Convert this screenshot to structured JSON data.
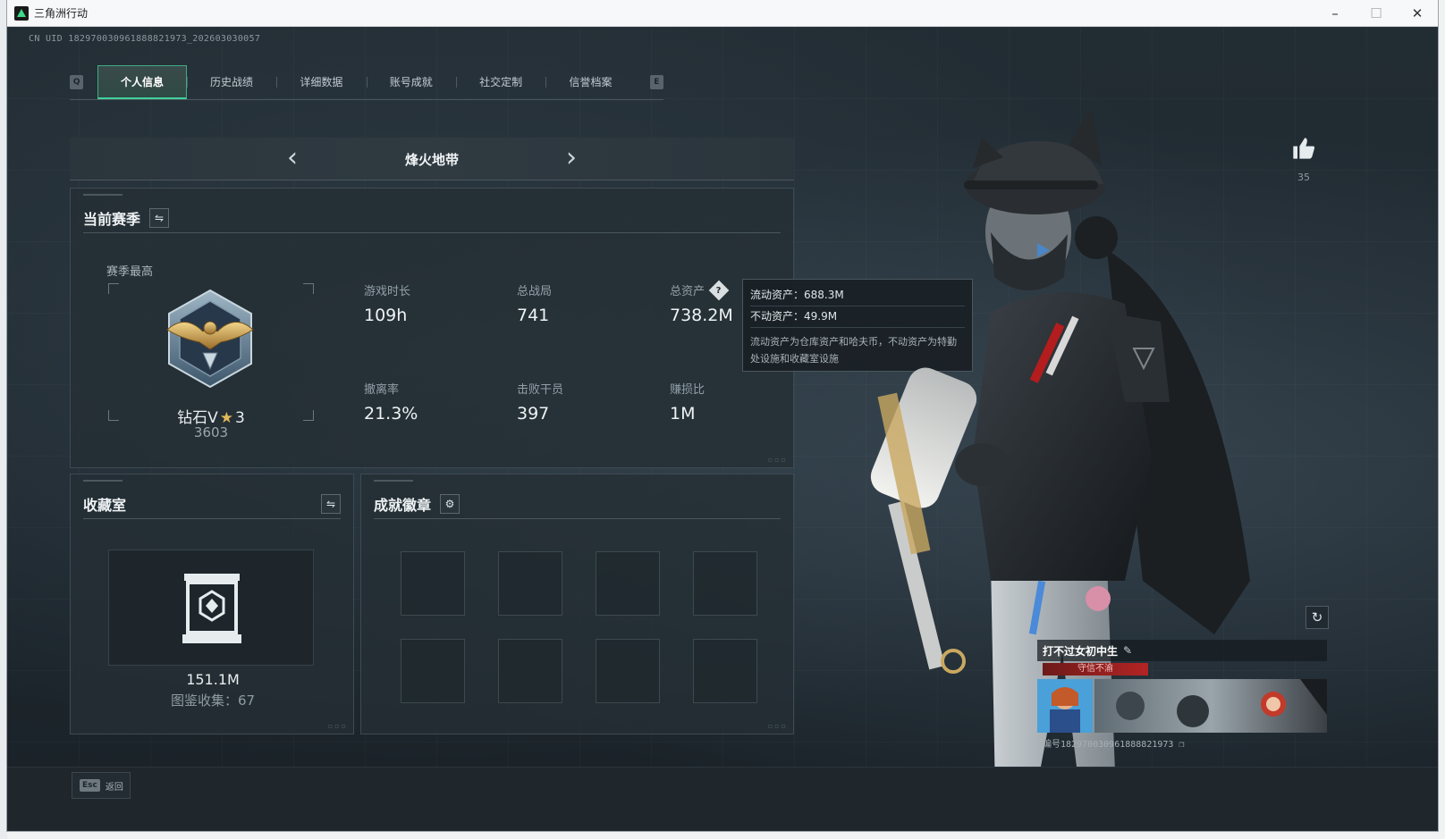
{
  "window": {
    "title": "三角洲行动",
    "controls": {
      "minimize": "–",
      "maximize": "☐",
      "close": "✕"
    }
  },
  "uid_text": "CN UID 1829700309618888219​73_202603030057",
  "tabs": {
    "left_key": "Q",
    "right_key": "E",
    "items": [
      {
        "label": "个人信息",
        "active": true
      },
      {
        "label": "历史战绩",
        "active": false
      },
      {
        "label": "详细数据",
        "active": false
      },
      {
        "label": "账号成就",
        "active": false
      },
      {
        "label": "社交定制",
        "active": false
      },
      {
        "label": "信誉档案",
        "active": false
      }
    ]
  },
  "mode": {
    "title": "烽火地带",
    "prev": "‹",
    "next": "›"
  },
  "season": {
    "title": "当前赛季",
    "swap_icon": "⇋",
    "best_label": "赛季最高",
    "rank_name": "钻石V",
    "rank_stars": "3",
    "rank_star_glyph": "★",
    "rank_score": "3603",
    "stats": [
      {
        "label": "游戏时长",
        "value": "109h"
      },
      {
        "label": "总战局",
        "value": "741"
      },
      {
        "label": "总资产",
        "value": "738.2M",
        "help": "?"
      },
      {
        "label": "撤离率",
        "value": "21.3%"
      },
      {
        "label": "击败干员",
        "value": "397"
      },
      {
        "label": "赚损比",
        "value": "1M"
      }
    ]
  },
  "tooltip": {
    "liquid": "流动资产：688.3M",
    "fixed": "不动资产：49.9M",
    "note": "流动资产为仓库资产和哈夫币，不动资产为特勤处设施和收藏室设施"
  },
  "collection": {
    "title": "收藏室",
    "swap_icon": "⇋",
    "value": "151.1M",
    "count_label": "图鉴收集：67"
  },
  "achievements": {
    "title": "成就徽章",
    "gear_icon": "⚙"
  },
  "profile": {
    "likes": "35",
    "refresh_icon": "↻",
    "name": "打不过女初中生",
    "edit_icon": "✎",
    "tag": "守信不渝",
    "id_text": "编号1829700309618888219​73"
  },
  "footer": {
    "esc_key": "Esc",
    "esc_label": "返回"
  },
  "colors": {
    "accent": "#3fd19a",
    "panel": "#242e35",
    "tag_red": "#b32424",
    "gold": "#e2b85a"
  }
}
